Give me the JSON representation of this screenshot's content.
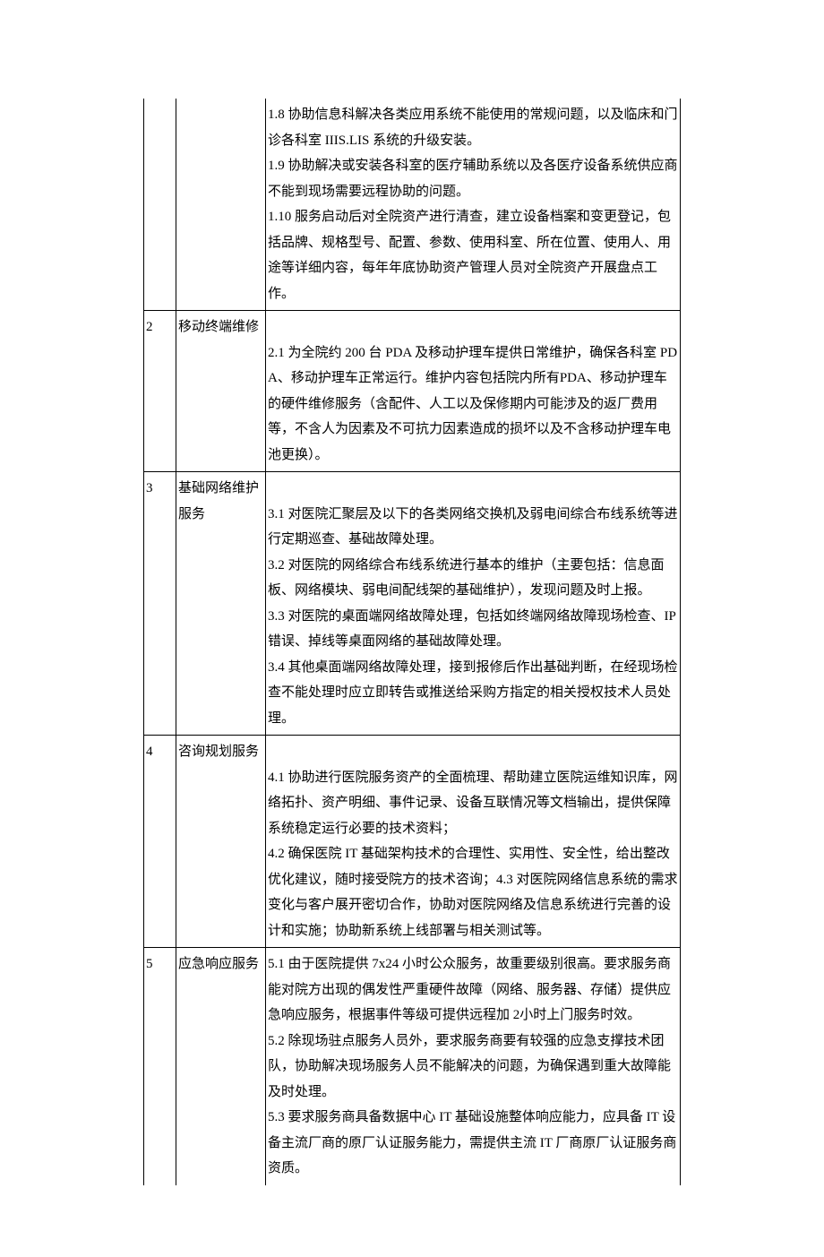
{
  "rows": [
    {
      "num": "",
      "name": "",
      "desc": "1.8 协助信息科解决各类应用系统不能使用的常规问题，以及临床和门诊各科室 IIIS.LIS 系统的升级安装。\n1.9 协助解决或安装各科室的医疗辅助系统以及各医疗设备系统供应商不能到现场需要远程协助的问题。\n1.10 服务启动后对全院资产进行清查，建立设备档案和变更登记，包括品牌、规格型号、配置、参数、使用科室、所在位置、使用人、用途等详细内容，每年年底协助资产管理人员对全院资产开展盘点工作。"
    },
    {
      "num": "2",
      "name": "移动终端维修",
      "desc": "\n2.1 为全院约 200 台 PDA 及移动护理车提供日常维护，确保各科室 PDA、移动护理车正常运行。维护内容包括院内所有PDA、移动护理车的硬件维修服务（含配件、人工以及保修期内可能涉及的返厂费用等，不含人为因素及不可抗力因素造成的损坏以及不含移动护理车电池更换）。"
    },
    {
      "num": "3",
      "name": "基础网络维护服务",
      "desc": "\n3.1  对医院汇聚层及以下的各类网络交换机及弱电间综合布线系统等进行定期巡查、基础故障处理。\n3.2  对医院的网络综合布线系统进行基本的维护（主要包括：信息面板、网络模块、弱电间配线架的基础维护），发现问题及时上报。\n3.3  对医院的桌面端网络故障处理，包括如终端网络故障现场检查、IP 错误、掉线等桌面网络的基础故障处理。\n3.4  其他桌面端网络故障处理，接到报修后作出基础判断，在经现场检查不能处理时应立即转告或推送给采购方指定的相关授权技术人员处理。"
    },
    {
      "num": "4",
      "name": "咨询规划服务",
      "desc": "\n4.1  协助进行医院服务资产的全面梳理、帮助建立医院运维知识库，网络拓扑、资产明细、事件记录、设备互联情况等文档输出，提供保障系统稳定运行必要的技术资料；\n4.2  确保医院 IT 基础架构技术的合理性、实用性、安全性，给出整改优化建议，随时接受院方的技术咨询；4.3 对医院网络信息系统的需求变化与客户展开密切合作，协助对医院网络及信息系统进行完善的设计和实施；协助新系统上线部署与相关测试等。"
    },
    {
      "num": "5",
      "name": "应急响应服务",
      "desc": "5.1 由于医院提供 7x24 小时公众服务，故重要级别很高。要求服务商能对院方出现的偶发性严重硬件故障（网络、服务器、存储）提供应急响应服务，根据事件等级可提供远程加 2小时上门服务时效。\n5.2 除现场驻点服务人员外，要求服务商要有较强的应急支撑技术团队，协助解决现场服务人员不能解决的问题，为确保遇到重大故障能及时处理。\n5.3 要求服务商具备数据中心 IT 基础设施整体响应能力，应具备 IT 设备主流厂商的原厂认证服务能力，需提供主流 IT 厂商原厂认证服务商资质。"
    }
  ]
}
